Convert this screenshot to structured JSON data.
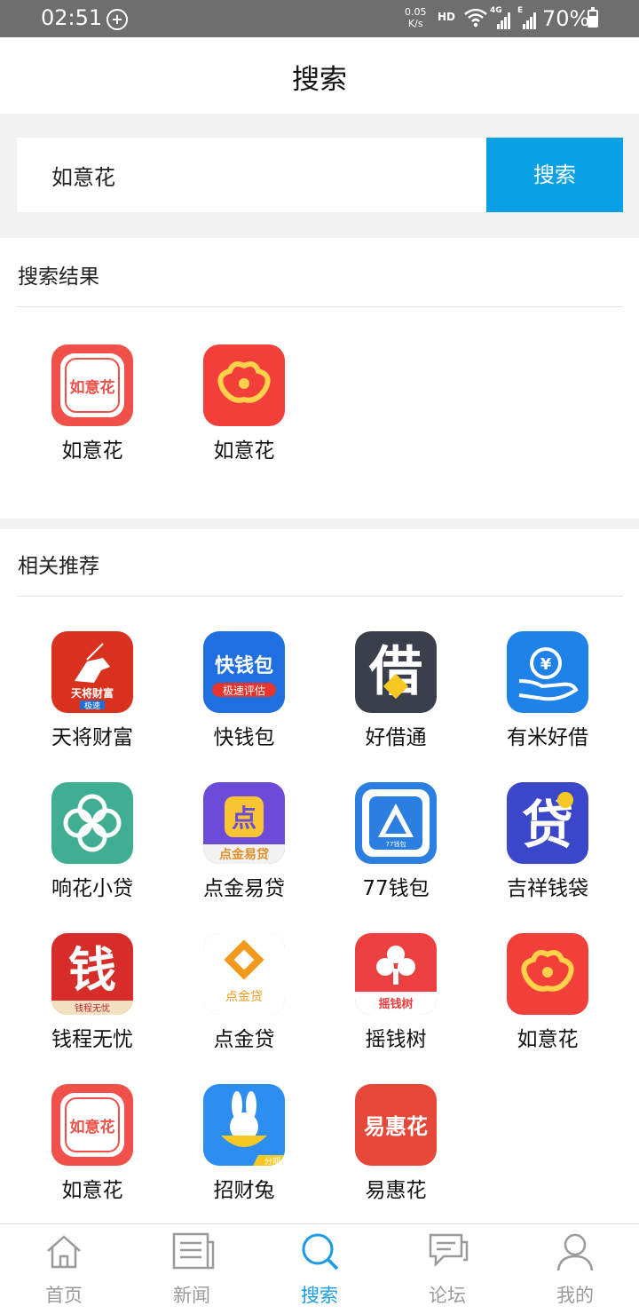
{
  "status_bar": {
    "time": "02:51",
    "net_speed_value": "0.05",
    "net_speed_unit": "K/s",
    "hd": "HD",
    "network": "4G",
    "network2": "E",
    "battery": "70%"
  },
  "header": {
    "title": "搜索"
  },
  "search": {
    "value": "如意花",
    "button_label": "搜索"
  },
  "results": {
    "title": "搜索结果",
    "items": [
      {
        "label": "如意花",
        "icon": "ruyihua-seal-icon",
        "color": "#f0504a",
        "icon_text": "如意花"
      },
      {
        "label": "如意花",
        "icon": "ruyihua-cloud-icon",
        "color": "#f23f3a"
      }
    ]
  },
  "recommend": {
    "title": "相关推荐",
    "items": [
      {
        "label": "天将财富",
        "icon": "tianjiang-horse-icon",
        "color": "#d8321e",
        "icon_text": "天将财富",
        "badge": "极速"
      },
      {
        "label": "快钱包",
        "icon": "kuaiqianbao-icon",
        "color": "#1f6fe0",
        "icon_text": "快钱包",
        "badge": "极速评估"
      },
      {
        "label": "好借通",
        "icon": "haojietong-icon",
        "color": "#3a3f4b",
        "icon_text": "借"
      },
      {
        "label": "有米好借",
        "icon": "youmi-hand-coin-icon",
        "color": "#1e82e8"
      },
      {
        "label": "响花小贷",
        "icon": "xianghua-clover-icon",
        "color": "#3fae93"
      },
      {
        "label": "点金易贷",
        "icon": "dianjin-yidai-icon",
        "color": "#6b4bd8",
        "icon_text": "点金易贷"
      },
      {
        "label": "77钱包",
        "icon": "77qianbao-triangle-icon",
        "color": "#2a7fe0",
        "icon_text": "77钱包"
      },
      {
        "label": "吉祥钱袋",
        "icon": "jixiang-dai-icon",
        "color": "#3a47c8",
        "icon_text": "贷"
      },
      {
        "label": "钱程无忧",
        "icon": "qiancheng-icon",
        "color": "#d62c2a",
        "icon_text": "钱",
        "badge": "钱程无忧"
      },
      {
        "label": "点金贷",
        "icon": "dianjindai-diamond-icon",
        "color": "#f39a1c",
        "icon_text": "点金贷"
      },
      {
        "label": "摇钱树",
        "icon": "yaoqianshu-tree-icon",
        "color": "#ec3f3f",
        "icon_text": "摇钱树"
      },
      {
        "label": "如意花",
        "icon": "ruyihua-cloud-icon",
        "color": "#f23f3a"
      },
      {
        "label": "如意花",
        "icon": "ruyihua-seal-icon",
        "color": "#f0504a",
        "icon_text": "如意花"
      },
      {
        "label": "招财兔",
        "icon": "zhaocaitu-rabbit-icon",
        "color": "#2c8ef0",
        "badge": "分期"
      },
      {
        "label": "易惠花",
        "icon": "yihuihua-icon",
        "color": "#e54838",
        "icon_text": "易惠花"
      }
    ]
  },
  "bottom_nav": [
    {
      "label": "首页",
      "icon": "home-icon",
      "active": false
    },
    {
      "label": "新闻",
      "icon": "news-icon",
      "active": false
    },
    {
      "label": "搜索",
      "icon": "search-icon",
      "active": true
    },
    {
      "label": "论坛",
      "icon": "forum-icon",
      "active": false
    },
    {
      "label": "我的",
      "icon": "profile-icon",
      "active": false
    }
  ],
  "colors": {
    "accent": "#0aa0e6",
    "nav_active": "#1a9be6",
    "nav_inactive": "#9a9a9a"
  }
}
